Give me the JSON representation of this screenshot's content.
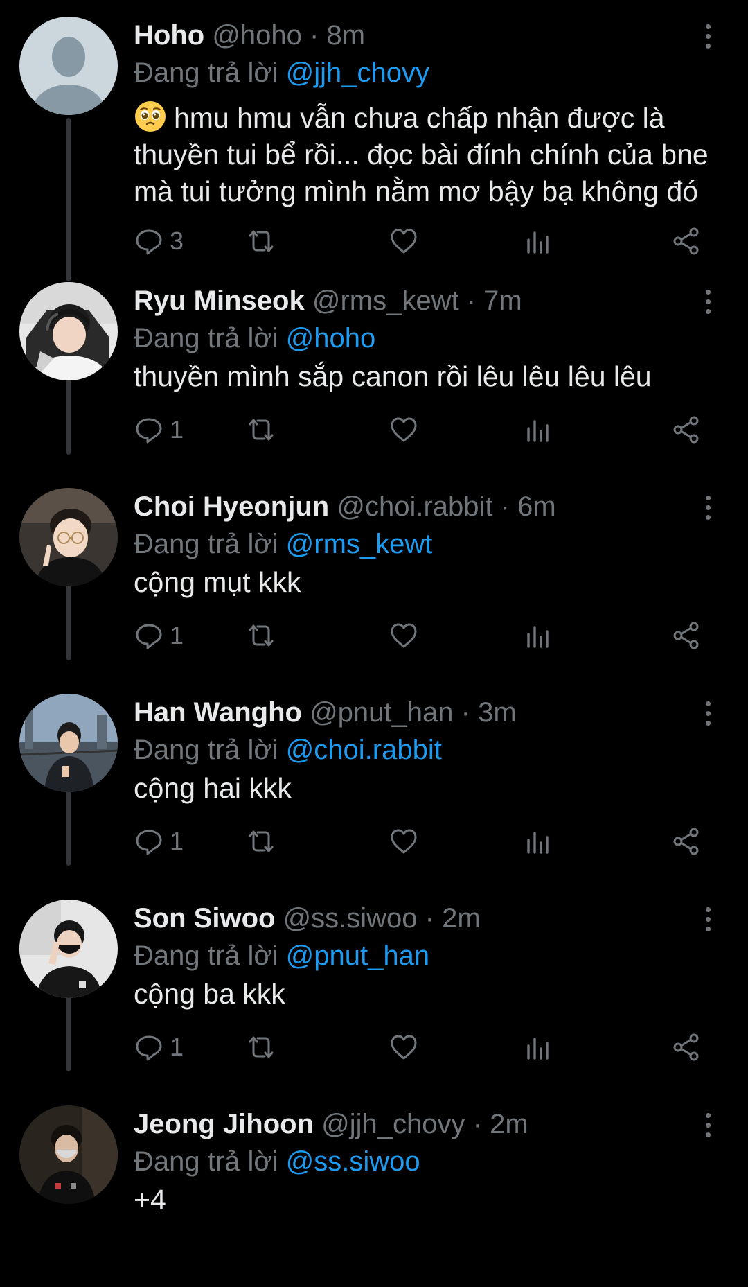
{
  "reply_prefix": "Đang trả lời",
  "colors": {
    "background": "#000000",
    "text": "#e7e9ea",
    "muted": "#71767b",
    "accent": "#1d9bf0",
    "thread_line": "#333639"
  },
  "icons": [
    "reply-icon",
    "retweet-icon",
    "like-icon",
    "views-icon",
    "share-icon",
    "more-icon"
  ],
  "tweets": [
    {
      "name": "Hoho",
      "handle": "@hoho",
      "separator": "·",
      "time": "8m",
      "reply_to": "@jjh_chovy",
      "emoji": "pleading-face-emoji",
      "text": "hmu hmu vẫn chưa chấp nhận được là thuyền tui bể rồi... đọc bài đính chính của bne mà tui tưởng mình nằm mơ bậy bạ không đó",
      "reply_count": "3"
    },
    {
      "name": "Ryu Minseok",
      "handle": "@rms_kewt",
      "separator": "·",
      "time": "7m",
      "reply_to": "@hoho",
      "text": "thuyền mình sắp canon rồi lêu lêu lêu lêu",
      "reply_count": "1"
    },
    {
      "name": "Choi Hyeonjun",
      "handle": "@choi.rabbit",
      "separator": "·",
      "time": "6m",
      "reply_to": "@rms_kewt",
      "text": "cộng mụt kkk",
      "reply_count": "1"
    },
    {
      "name": "Han Wangho",
      "handle": "@pnut_han",
      "separator": "·",
      "time": "3m",
      "reply_to": "@choi.rabbit",
      "text": "cộng hai kkk",
      "reply_count": "1"
    },
    {
      "name": "Son Siwoo",
      "handle": "@ss.siwoo",
      "separator": "·",
      "time": "2m",
      "reply_to": "@pnut_han",
      "text": "cộng ba kkk",
      "reply_count": "1"
    },
    {
      "name": "Jeong Jihoon",
      "handle": "@jjh_chovy",
      "separator": "·",
      "time": "2m",
      "reply_to": "@ss.siwoo",
      "text": "+4"
    }
  ]
}
